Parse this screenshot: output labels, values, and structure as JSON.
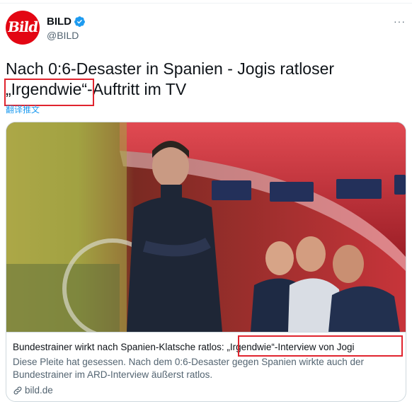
{
  "account": {
    "avatar_text": "Bild",
    "name": "BILD",
    "handle": "@BILD",
    "more": "···"
  },
  "tweet": {
    "text": "Nach 0:6-Desaster in Spanien - Jogis ratloser „Irgendwie“-Auftritt im TV",
    "translate_label": "翻译推文"
  },
  "card": {
    "title": "Bundestrainer wirkt nach Spanien-Klatsche ratlos: „Irgendwie“-Interview von Jogi",
    "description": "Diese Pleite hat gesessen. Nach dem 0:6-Desaster gegen Spanien wirkte auch der Bundestrainer im ARD-Interview äußerst ratlos.",
    "domain": "bild.de"
  },
  "colors": {
    "brand_red": "#e30613",
    "highlight_box": "#e0242e",
    "link_blue": "#1d9bf0",
    "verified_blue": "#1d9bf0"
  }
}
